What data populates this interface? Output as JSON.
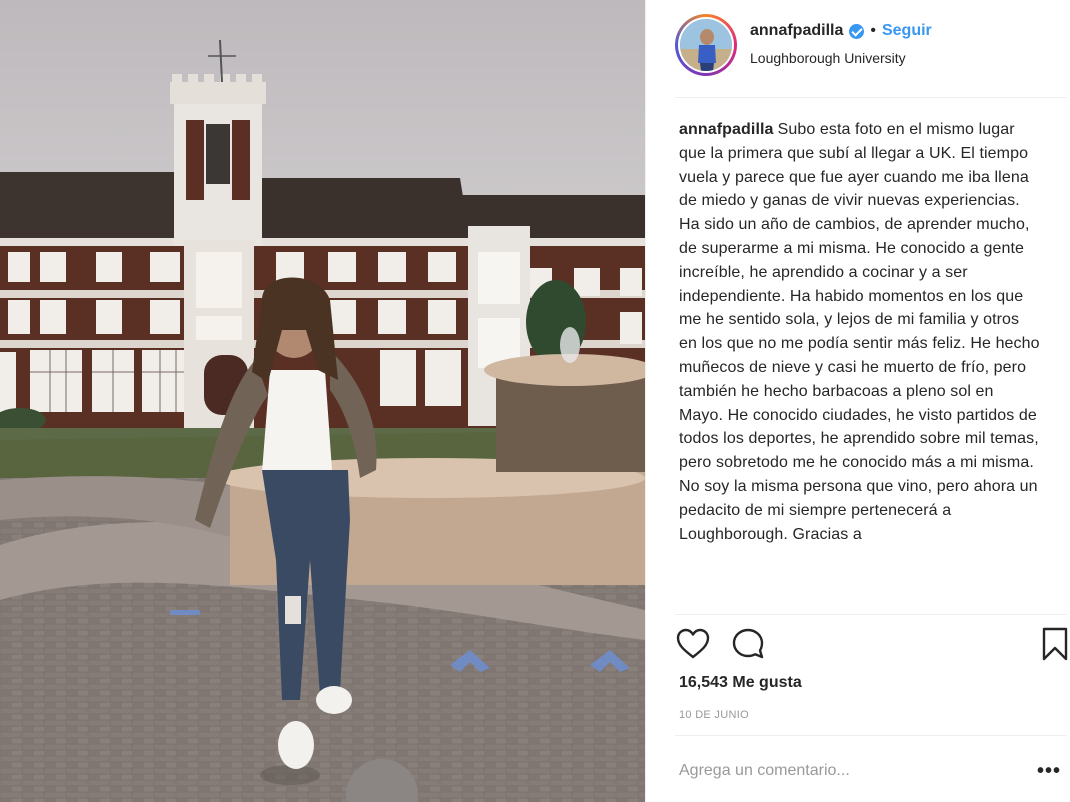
{
  "post": {
    "username": "annafpadilla",
    "follow_label": "Seguir",
    "dot": "•",
    "location": "Loughborough University",
    "caption_user": "annafpadilla",
    "caption_text": "Subo esta foto en el mismo lugar que la primera que subí al llegar a UK. El tiempo vuela y parece que fue ayer cuando me iba llena de miedo y ganas de vivir nuevas experiencias. Ha sido un año de cambios, de aprender mucho, de superarme a mi misma. He conocido a gente increíble, he aprendido a cocinar y a ser independiente. Ha habido momentos en los que me he sentido sola, y lejos de mi familia y otros en los que no me podía sentir más feliz. He hecho muñecos de nieve y casi he muerto de frío, pero también he hecho barbacoas a pleno sol en Mayo. He conocido ciudades, he visto partidos de todos los deportes, he aprendido sobre mil temas, pero sobretodo me he conocido más a mi misma. No soy la misma persona que vino, pero ahora un pedacito de mi siempre pertenecerá a Loughborough. Gracias a",
    "likes": "16,543 Me gusta",
    "date": "10 DE JUNIO",
    "comment_placeholder": "Agrega un comentario...",
    "more_label": "•••"
  },
  "icons": {
    "verified": "verified-badge-icon",
    "like": "heart-icon",
    "comment": "comment-icon",
    "save": "bookmark-icon",
    "more": "more-options-icon"
  },
  "colors": {
    "link_blue": "#3897f0",
    "text": "#262626",
    "muted": "#999999",
    "divider": "#efefef"
  }
}
